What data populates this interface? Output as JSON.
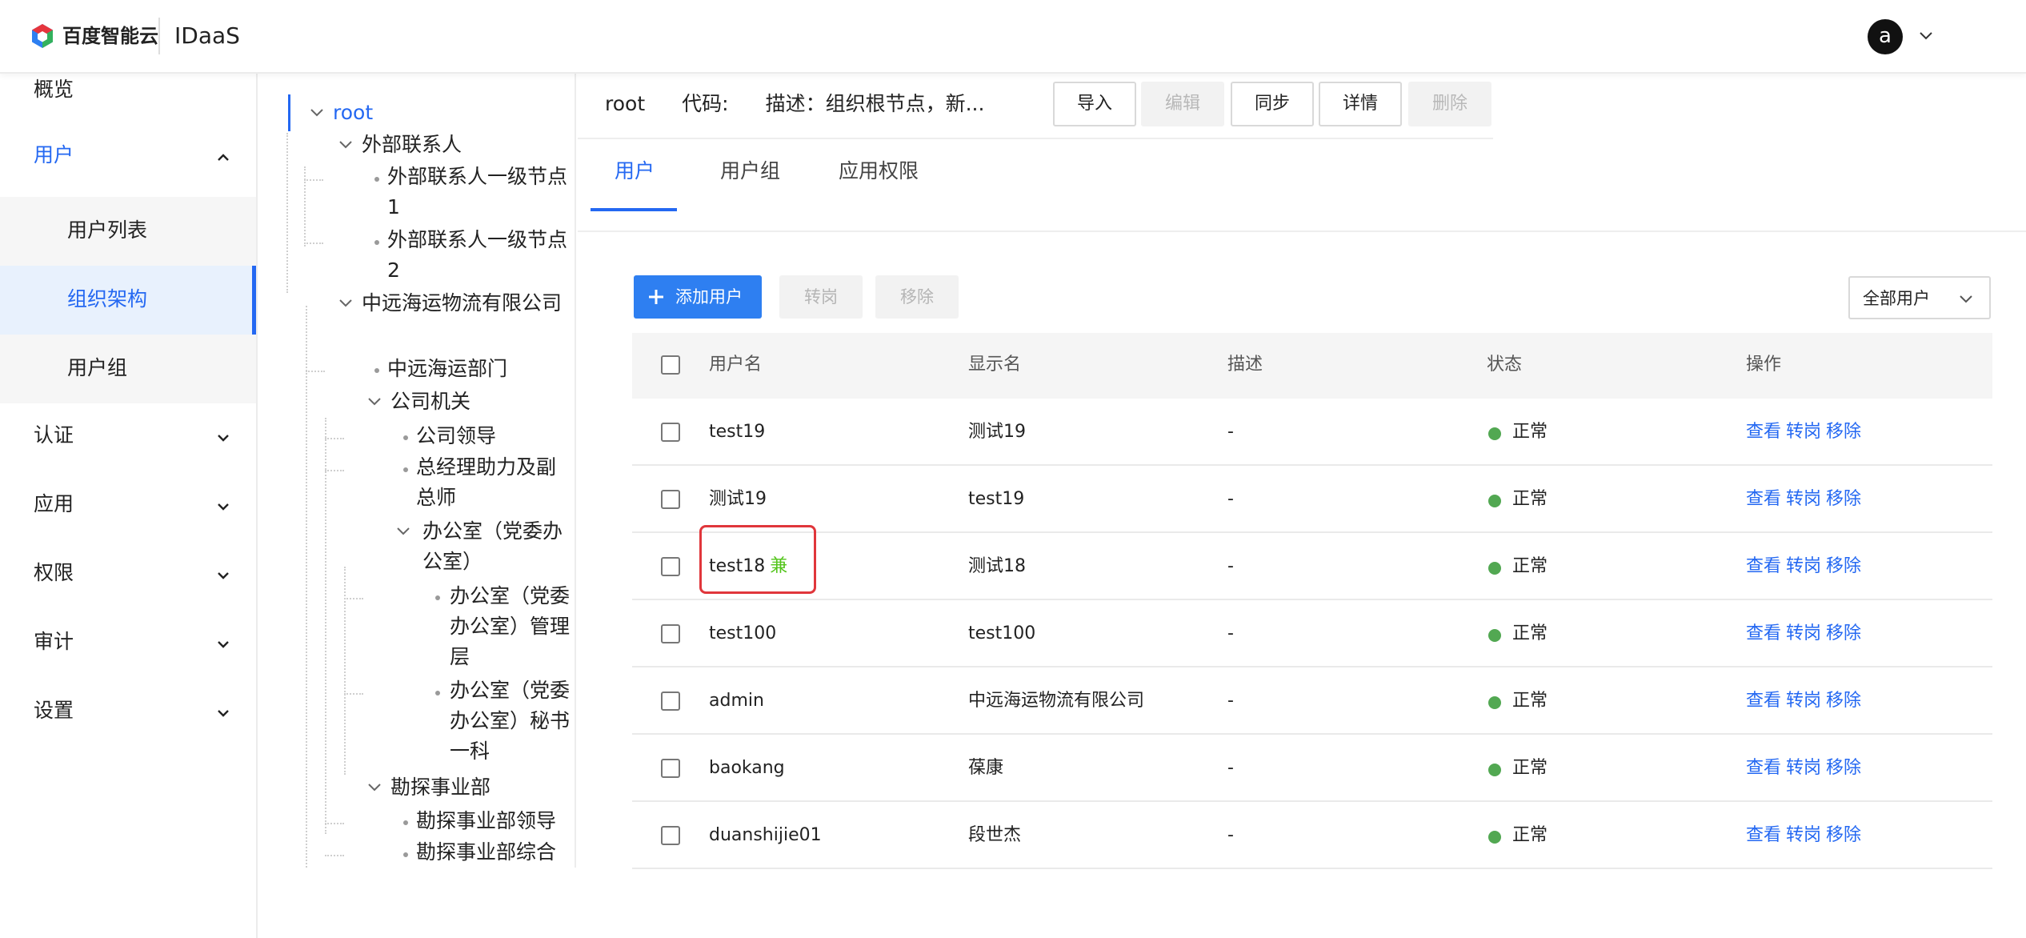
{
  "topbar": {
    "brand": "百度智能云",
    "product": "IDaaS",
    "avatar_letter": "a",
    "brand_colors": [
      "#e6353d",
      "#2e7ff1",
      "#33b15d"
    ]
  },
  "sidebar": {
    "overview": "概览",
    "users": "用户",
    "user_list": "用户列表",
    "org_structure": "组织架构",
    "user_group": "用户组",
    "auth": "认证",
    "apps": "应用",
    "permissions": "权限",
    "audit": "审计",
    "settings": "设置"
  },
  "tree": {
    "root": "root",
    "external": "外部联系人",
    "external_1": "外部联系人一级节点1",
    "external_2": "外部联系人一级节点2",
    "cosco": "中远海运物流有限公司",
    "cosco_dept": "中远海运部门",
    "company_org": "公司机关",
    "leaders": "公司领导",
    "gm_assist": "总经理助力及副总师",
    "office": "办公室（党委办公室）",
    "office_mgmt": "办公室（党委办公室）管理层",
    "office_sec": "办公室（党委办公室）秘书一科",
    "survey": "勘探事业部",
    "survey_leader": "勘探事业部领导",
    "survey_general": "勘探事业部综合"
  },
  "header": {
    "name": "root",
    "code_label": "代码:",
    "desc": "描述：组织根节点，新...",
    "buttons": {
      "import": "导入",
      "edit": "编辑",
      "sync": "同步",
      "detail": "详情",
      "delete": "删除"
    }
  },
  "tabs": {
    "users": "用户",
    "groups": "用户组",
    "app_perms": "应用权限"
  },
  "actions": {
    "add_user": "添加用户",
    "transfer": "转岗",
    "remove": "移除",
    "filter": "全部用户"
  },
  "table": {
    "headers": {
      "username": "用户名",
      "display": "显示名",
      "desc": "描述",
      "status": "状态",
      "ops": "操作"
    },
    "op_labels": {
      "view": "查看",
      "transfer": "转岗",
      "remove": "移除"
    },
    "part_time_tag": "兼",
    "status_color": "#52a852",
    "rows": [
      {
        "username": "test19",
        "display": "测试19",
        "desc": "-",
        "status": "正常"
      },
      {
        "username": "测试19",
        "display": "test19",
        "desc": "-",
        "status": "正常"
      },
      {
        "username": "test18",
        "display": "测试18",
        "desc": "-",
        "status": "正常"
      },
      {
        "username": "test100",
        "display": "test100",
        "desc": "-",
        "status": "正常"
      },
      {
        "username": "admin",
        "display": "中远海运物流有限公司",
        "desc": "-",
        "status": "正常"
      },
      {
        "username": "baokang",
        "display": "葆康",
        "desc": "-",
        "status": "正常"
      },
      {
        "username": "duanshijie01",
        "display": "段世杰",
        "desc": "-",
        "status": "正常"
      }
    ]
  }
}
